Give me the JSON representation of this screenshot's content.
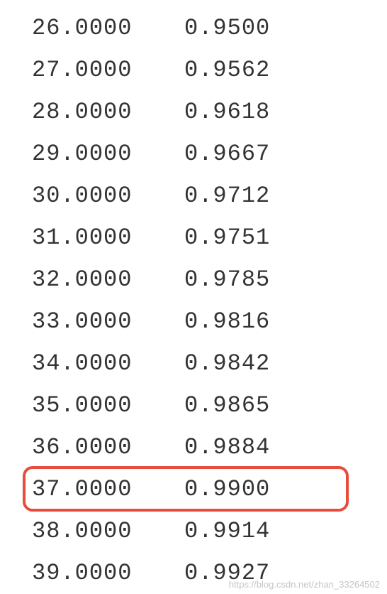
{
  "rows": [
    {
      "col1": "26.0000",
      "col2": "0.9500",
      "highlighted": false
    },
    {
      "col1": "27.0000",
      "col2": "0.9562",
      "highlighted": false
    },
    {
      "col1": "28.0000",
      "col2": "0.9618",
      "highlighted": false
    },
    {
      "col1": "29.0000",
      "col2": "0.9667",
      "highlighted": false
    },
    {
      "col1": "30.0000",
      "col2": "0.9712",
      "highlighted": false
    },
    {
      "col1": "31.0000",
      "col2": "0.9751",
      "highlighted": false
    },
    {
      "col1": "32.0000",
      "col2": "0.9785",
      "highlighted": false
    },
    {
      "col1": "33.0000",
      "col2": "0.9816",
      "highlighted": false
    },
    {
      "col1": "34.0000",
      "col2": "0.9842",
      "highlighted": false
    },
    {
      "col1": "35.0000",
      "col2": "0.9865",
      "highlighted": false
    },
    {
      "col1": "36.0000",
      "col2": "0.9884",
      "highlighted": false
    },
    {
      "col1": "37.0000",
      "col2": "0.9900",
      "highlighted": true
    },
    {
      "col1": "38.0000",
      "col2": "0.9914",
      "highlighted": false
    },
    {
      "col1": "39.0000",
      "col2": "0.9927",
      "highlighted": false
    }
  ],
  "watermark": "https://blog.csdn.net/zhan_33264502"
}
